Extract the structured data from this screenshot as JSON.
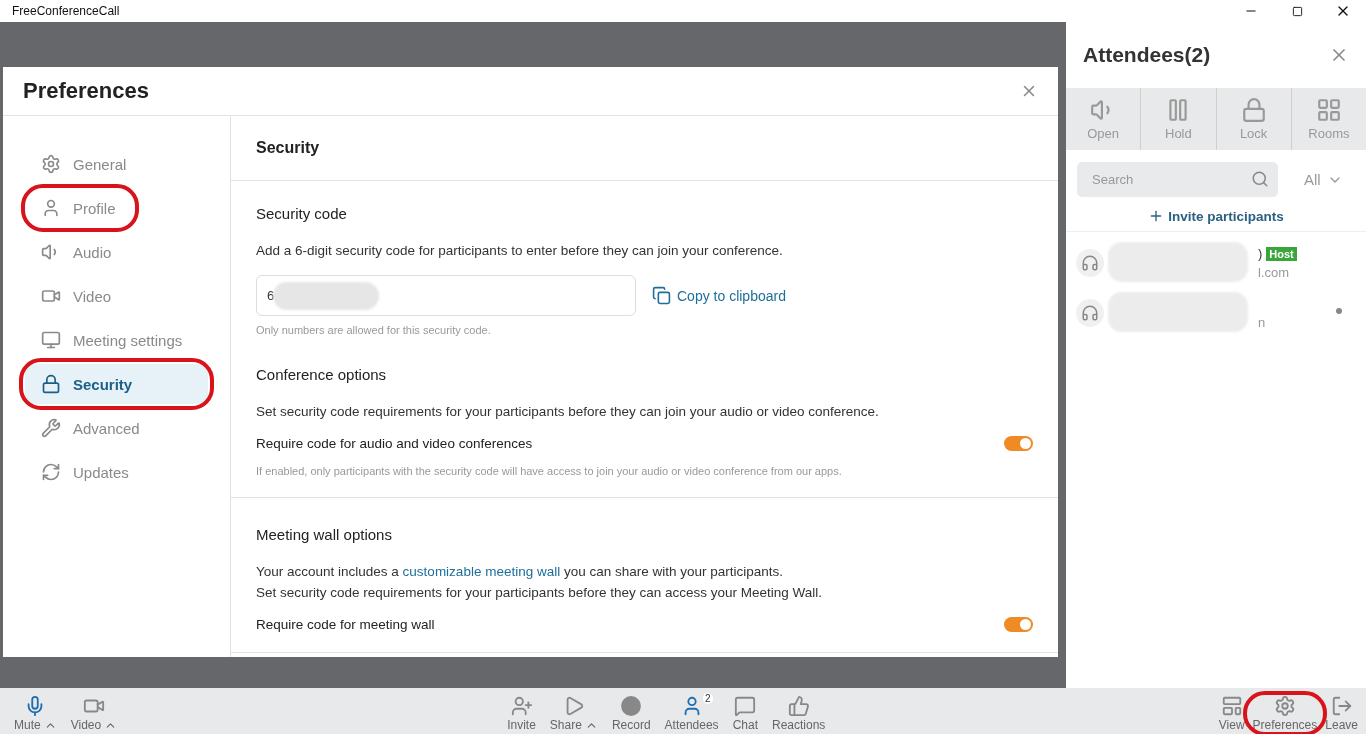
{
  "window": {
    "title": "FreeConferenceCall"
  },
  "preferences": {
    "title": "Preferences",
    "nav": [
      {
        "label": "General",
        "selected": false,
        "highlighted": false
      },
      {
        "label": "Profile",
        "selected": false,
        "highlighted": true
      },
      {
        "label": "Audio",
        "selected": false,
        "highlighted": false
      },
      {
        "label": "Video",
        "selected": false,
        "highlighted": false
      },
      {
        "label": "Meeting settings",
        "selected": false,
        "highlighted": false
      },
      {
        "label": "Security",
        "selected": true,
        "highlighted": true
      },
      {
        "label": "Advanced",
        "selected": false,
        "highlighted": false
      },
      {
        "label": "Updates",
        "selected": false,
        "highlighted": false
      }
    ],
    "heading": "Security",
    "security_code": {
      "title": "Security code",
      "description": "Add a 6-digit security code for participants to enter before they can join your conference.",
      "value": "6",
      "copy_label": "Copy to clipboard",
      "hint": "Only numbers are allowed for this security code."
    },
    "conference_options": {
      "title": "Conference options",
      "description": "Set security code requirements for your participants before they can join your audio or video conference.",
      "toggle_label": "Require code for audio and video conferences",
      "on": true,
      "hint": "If enabled, only participants with the security code will have access to join your audio or video conference from our apps."
    },
    "meeting_wall": {
      "title": "Meeting wall options",
      "description_before": "Your account includes a ",
      "link": "customizable meeting wall",
      "description_after": " you can share with your participants.",
      "description_2": "Set security code requirements for your participants before they can access your Meeting Wall.",
      "toggle_label": "Require code for meeting wall",
      "on": true
    }
  },
  "attendees_panel": {
    "title": "Attendees(2)",
    "tools": [
      {
        "label": "Open"
      },
      {
        "label": "Hold"
      },
      {
        "label": "Lock"
      },
      {
        "label": "Rooms"
      }
    ],
    "search": {
      "placeholder": "Search"
    },
    "filter": "All",
    "invite": "Invite participants",
    "attendees": [
      {
        "name_tail": ")",
        "badge": "Host",
        "detail_tail": "l.com",
        "online": false
      },
      {
        "detail_tail": "n",
        "online": true
      }
    ]
  },
  "toolbar": {
    "left": [
      {
        "label": "Mute",
        "caret": true,
        "active": true
      },
      {
        "label": "Video",
        "caret": true,
        "active": false
      }
    ],
    "center": [
      {
        "label": "Invite",
        "caret": false,
        "active": false
      },
      {
        "label": "Share",
        "caret": true,
        "active": false
      },
      {
        "label": "Record",
        "caret": false,
        "active": false
      },
      {
        "label": "Attendees",
        "caret": false,
        "active": true,
        "badge": "2"
      },
      {
        "label": "Chat",
        "caret": false,
        "active": false
      },
      {
        "label": "Reactions",
        "caret": false,
        "active": false
      }
    ],
    "right": [
      {
        "label": "View",
        "highlighted": false
      },
      {
        "label": "Preferences",
        "highlighted": true
      },
      {
        "label": "Leave",
        "highlighted": false
      }
    ]
  }
}
